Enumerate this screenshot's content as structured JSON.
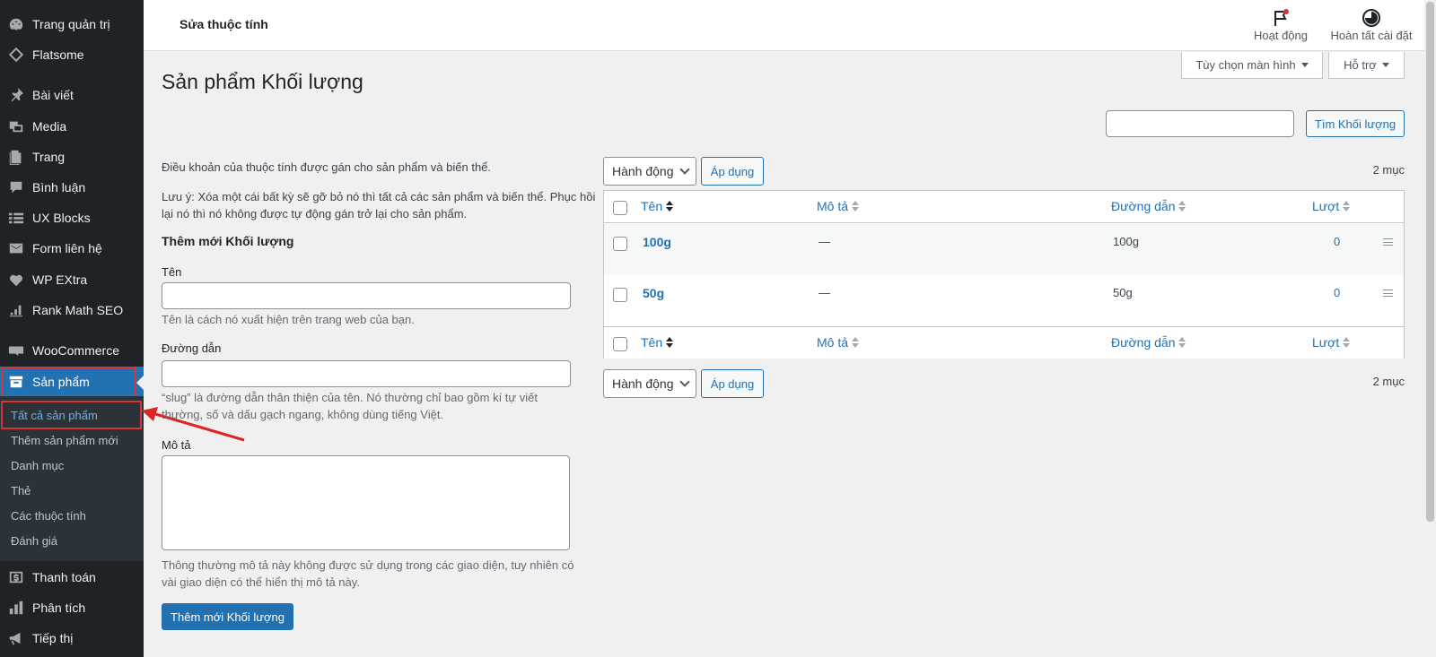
{
  "sidebar": {
    "items": [
      {
        "label": "Trang quản trị",
        "icon": "dashboard-icon"
      },
      {
        "label": "Flatsome",
        "icon": "diamond-icon"
      },
      {
        "label": "Bài viết",
        "icon": "pin-icon"
      },
      {
        "label": "Media",
        "icon": "media-icon"
      },
      {
        "label": "Trang",
        "icon": "page-icon"
      },
      {
        "label": "Bình luận",
        "icon": "comment-icon"
      },
      {
        "label": "UX Blocks",
        "icon": "blocks-icon"
      },
      {
        "label": "Form liên hệ",
        "icon": "mail-icon"
      },
      {
        "label": "WP EXtra",
        "icon": "heart-icon"
      },
      {
        "label": "Rank Math SEO",
        "icon": "chart-icon"
      },
      {
        "label": "WooCommerce",
        "icon": "woo-icon"
      },
      {
        "label": "Sản phẩm",
        "icon": "archive-icon"
      },
      {
        "label": "Thanh toán",
        "icon": "dollar-icon"
      },
      {
        "label": "Phân tích",
        "icon": "bars-icon"
      },
      {
        "label": "Tiếp thị",
        "icon": "megaphone-icon"
      }
    ],
    "submenu": [
      {
        "label": "Tất cả sản phẩm"
      },
      {
        "label": "Thêm sản phẩm mới"
      },
      {
        "label": "Danh mục"
      },
      {
        "label": "Thẻ"
      },
      {
        "label": "Các thuộc tính"
      },
      {
        "label": "Đánh giá"
      }
    ]
  },
  "topbar": {
    "title": "Sửa thuộc tính",
    "activity_label": "Hoạt động",
    "finish_setup_label": "Hoàn tất cài đặt"
  },
  "screen_options_label": "Tùy chọn màn hình",
  "help_label": "Hỗ trợ",
  "page_title": "Sản phẩm Khối lượng",
  "search": {
    "value": "",
    "button_label": "Tìm Khối lượng"
  },
  "form": {
    "intro": "Điều khoản của thuộc tính được gán cho sản phẩm và biến thể.",
    "note_line1": "Lưu ý: Xóa một cái bất kỳ sẽ gỡ bỏ nó thì tất cả các sản phẩm và biến thể. Phục hồi",
    "note_line2": "lại nó thì nó không được tự động gán trở lại cho sản phẩm.",
    "heading": "Thêm mới Khối lượng",
    "name_label": "Tên",
    "name_value": "",
    "name_help": "Tên là cách nó xuất hiện trên trang web của bạn.",
    "slug_label": "Đường dẫn",
    "slug_value": "",
    "slug_help_line1": "“slug” là đường dẫn thân thiện của tên. Nó thường chỉ bao gồm kí tự viết",
    "slug_help_line2": "thường, số và dấu gạch ngang, không dùng tiếng Việt.",
    "desc_label": "Mô tả",
    "desc_value": "",
    "desc_help_line1": "Thông thường mô tả này không được sử dụng trong các giao diện, tuy nhiên có",
    "desc_help_line2": "vài giao diện có thể hiển thị mô tả này.",
    "submit_label": "Thêm mới Khối lượng"
  },
  "bulk": {
    "action_label": "Hành động",
    "apply_label": "Áp dụng",
    "count_label": "2 mục"
  },
  "table": {
    "columns": [
      "Tên",
      "Mô tả",
      "Đường dẫn",
      "Lượt"
    ],
    "rows": [
      {
        "name": "100g",
        "description": "—",
        "slug": "100g",
        "count": "0"
      },
      {
        "name": "50g",
        "description": "—",
        "slug": "50g",
        "count": "0"
      }
    ]
  },
  "colors": {
    "sidebar_bg": "#1d2327",
    "accent": "#2271b1",
    "highlight": "#d63638"
  }
}
